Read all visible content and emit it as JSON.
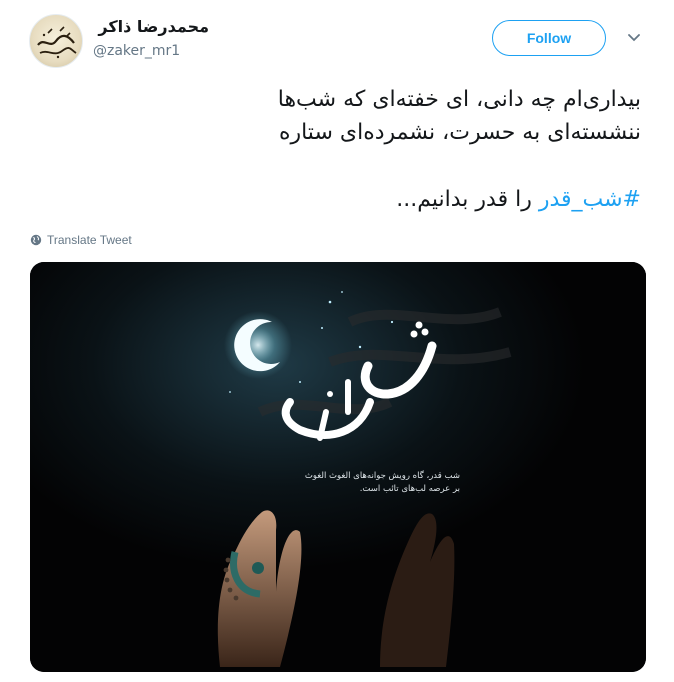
{
  "user": {
    "display_name": "محمدرضا ذاکر",
    "handle": "@zaker_mr1"
  },
  "header": {
    "follow_label": "Follow",
    "menu_icon": "chevron-down-icon"
  },
  "tweet": {
    "lines": [
      "بیداری‌ام چه دانی، ای خفته‌ای که شب‌ها",
      "ننشسته‌ای به حسرت، نشمرده‌ای ستاره"
    ],
    "hashtag": "#شب_قدر",
    "closing": " را قدر بدانیم..."
  },
  "translate": {
    "label": "Translate Tweet",
    "icon": "globe-icon"
  },
  "media": {
    "caption_line1": "شب قدر، گاه رویش جوانه‌های الغوث الغوث",
    "caption_line2": "بر عرصه لب‌های تائب است."
  },
  "colors": {
    "accent": "#1da1f2",
    "text": "#14171a",
    "muted": "#657786"
  }
}
